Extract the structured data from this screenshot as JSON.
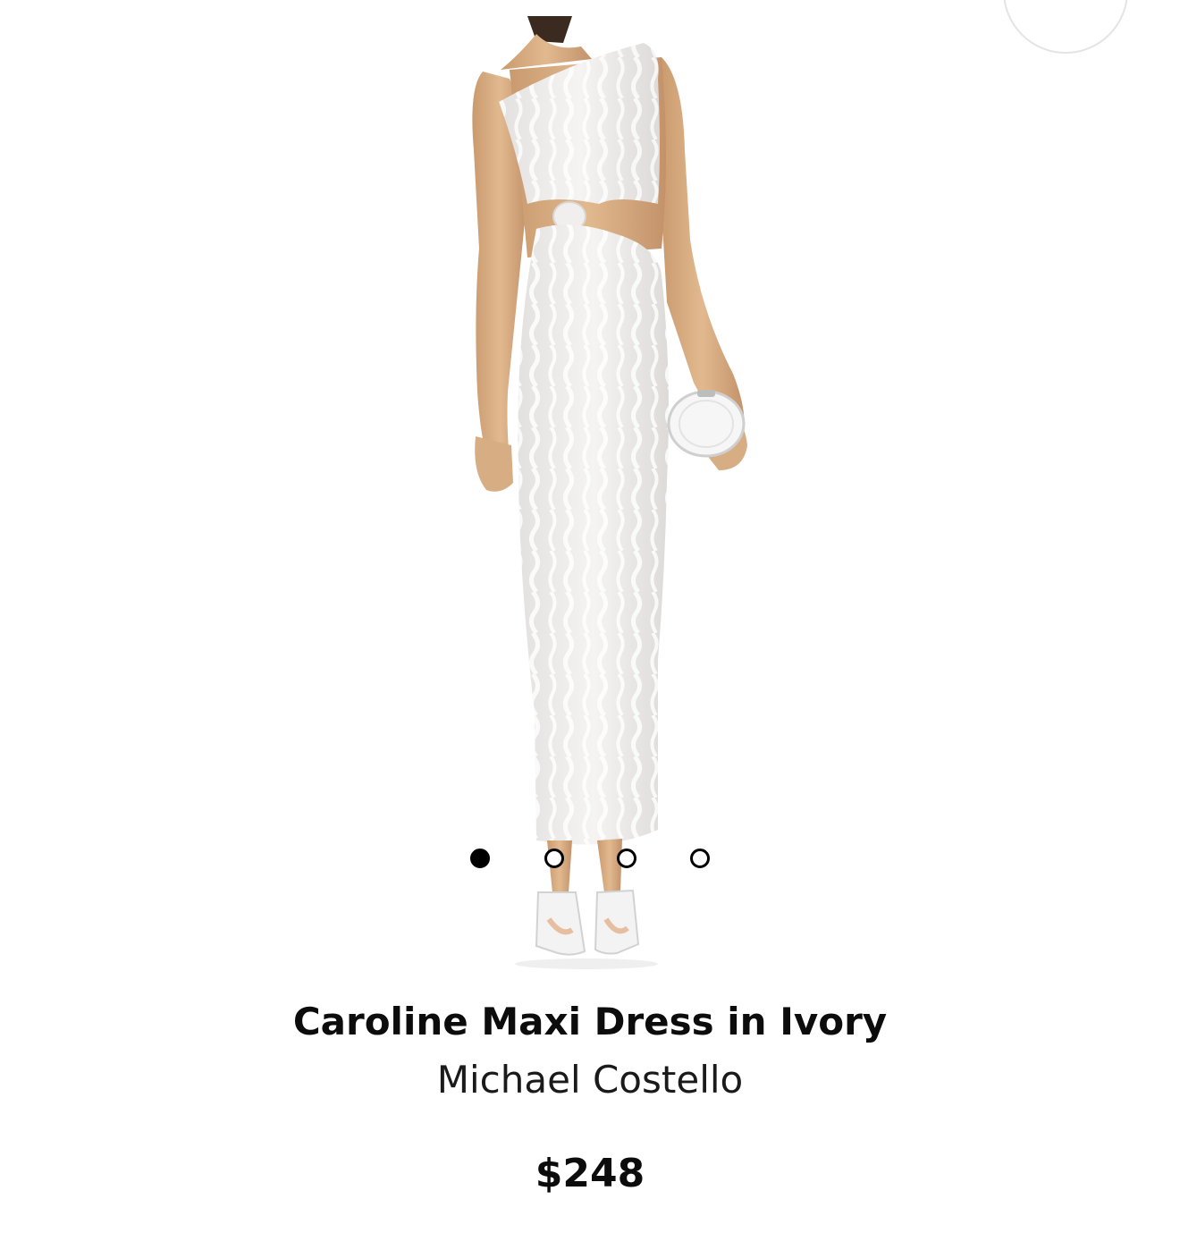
{
  "product": {
    "title": "Caroline Maxi Dress in Ivory",
    "brand": "Michael Costello",
    "price": "$248"
  },
  "gallery": {
    "image_alt": "Caroline Maxi Dress in Ivory",
    "image_count": 4,
    "active_index": 0
  },
  "colors": {
    "background": "#ffffff",
    "text": "#0c0c0c",
    "dot_active": "#000000",
    "dot_inactive": "#ffffff"
  }
}
